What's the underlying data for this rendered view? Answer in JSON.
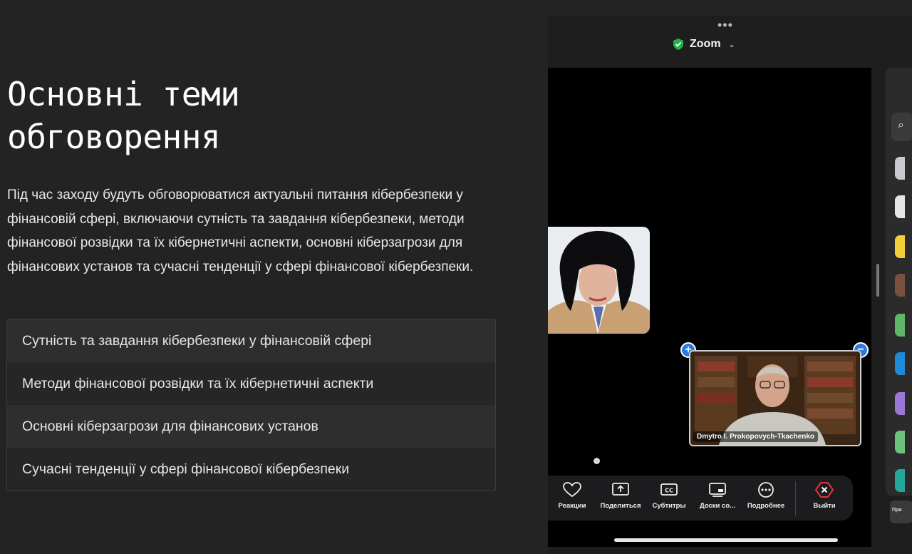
{
  "article": {
    "title": "Основні теми обговорення",
    "description": "Під час заходу будуть обговорюватися актуальні питання кібербезпеки у фінансовій сфері, включаючи сутність та завдання кібербезпеки, методи фінансової розвідки та їх кібернетичні аспекти, основні кіберзагрози для фінансових установ та сучасні тенденції у сфері фінансової кібербезпеки.",
    "topics": [
      "Сутність та завдання кібербезпеки у фінансовій сфері",
      "Методи фінансової розвідки та їх кібернетичні аспекти",
      "Основні кіберзагрози для фінансових установ",
      "Сучасні тенденції у сфері фінансової кібербезпеки"
    ]
  },
  "zoom": {
    "app_name": "Zoom",
    "menu_dots": "•••",
    "participant_name": "Dmytro I. Prokopovych-Tkachenko",
    "toolbar": {
      "reactions": "Реакции",
      "share": "Поделиться",
      "captions": "Субтитры",
      "whiteboards": "Доски со...",
      "more": "Подробнее",
      "leave": "Выйти"
    },
    "side_panel_hint": "При"
  },
  "colors": {
    "accent_green": "#23b14d",
    "leave_red": "#e0343b",
    "control_blue": "#2a7ae2"
  }
}
